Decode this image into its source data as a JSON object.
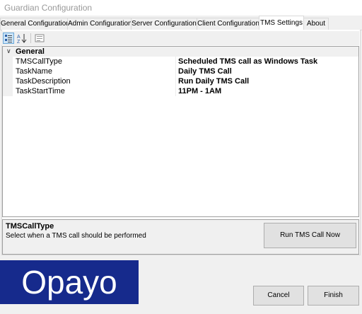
{
  "window": {
    "title": "Guardian Configuration"
  },
  "tabs": [
    {
      "label": "General Configuration"
    },
    {
      "label": "Admin Configuration"
    },
    {
      "label": "Server Configuration"
    },
    {
      "label": "Client Configuration"
    },
    {
      "label": "TMS Settings",
      "active": true
    },
    {
      "label": "About"
    }
  ],
  "toolbar": {
    "buttons": [
      {
        "icon": "categorized-icon",
        "selected": true
      },
      {
        "icon": "sort-alphabetical-icon",
        "selected": false
      },
      {
        "icon": "property-pages-icon",
        "selected": false
      }
    ]
  },
  "property_grid": {
    "category": "General",
    "properties": [
      {
        "name": "TMSCallType",
        "value": "Scheduled TMS call as Windows Task"
      },
      {
        "name": "TaskName",
        "value": "Daily TMS Call"
      },
      {
        "name": "TaskDescription",
        "value": "Run Daily TMS Call"
      },
      {
        "name": "TaskStartTime",
        "value": "11PM - 1AM"
      }
    ]
  },
  "help": {
    "title": "TMSCallType",
    "description": "Select when a TMS call should be performed",
    "button_label": "Run TMS Call Now"
  },
  "logo": {
    "text": "Opayo",
    "background": "#162a8c"
  },
  "footer": {
    "cancel_label": "Cancel",
    "finish_label": "Finish"
  }
}
